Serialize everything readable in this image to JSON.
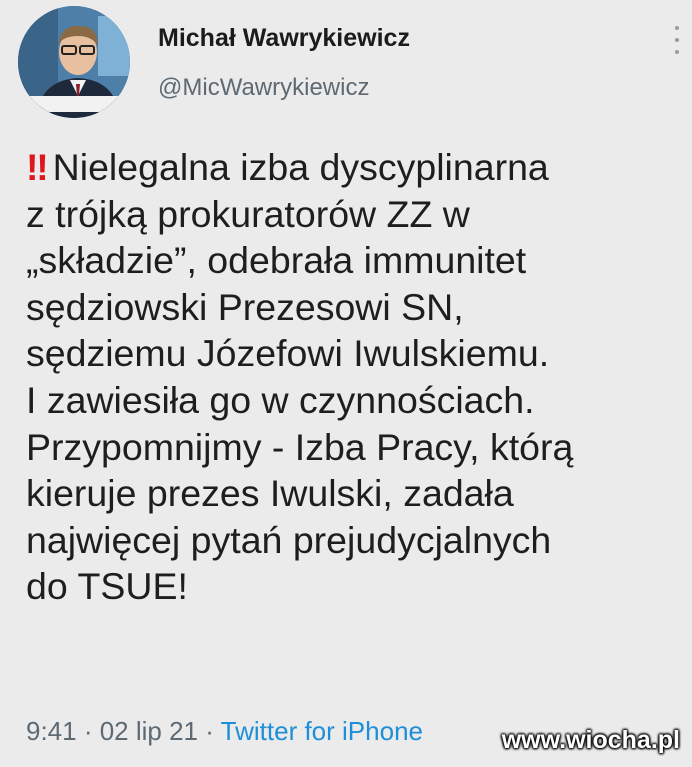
{
  "author": {
    "name": "Michał Wawrykiewicz",
    "handle": "@MicWawrykiewicz"
  },
  "tweet": {
    "emoji": "‼",
    "lines": [
      "Nielegalna izba dyscyplinarna",
      "z trójką prokuratorów ZZ w",
      "„składzie”, odebrała immunitet",
      "sędziowski Prezesowi SN,",
      "sędziemu Józefowi Iwulskiemu.",
      "I zawiesiła go w czynnościach.",
      "Przypomnijmy - Izba Pracy, którą",
      "kieruje prezes Iwulski, zadała",
      "najwięcej pytań prejudycjalnych",
      "do TSUE!"
    ]
  },
  "meta": {
    "time": "9:41",
    "sep1": " · ",
    "date": "02 lip 21",
    "sep2": " · ",
    "source": "Twitter for iPhone"
  },
  "watermark": "www.wiocha.pl",
  "colors": {
    "background": "#ebebeb",
    "source_link": "#1d8fd8",
    "emoji_red": "#e0161e",
    "secondary_text": "#5e6a73"
  }
}
